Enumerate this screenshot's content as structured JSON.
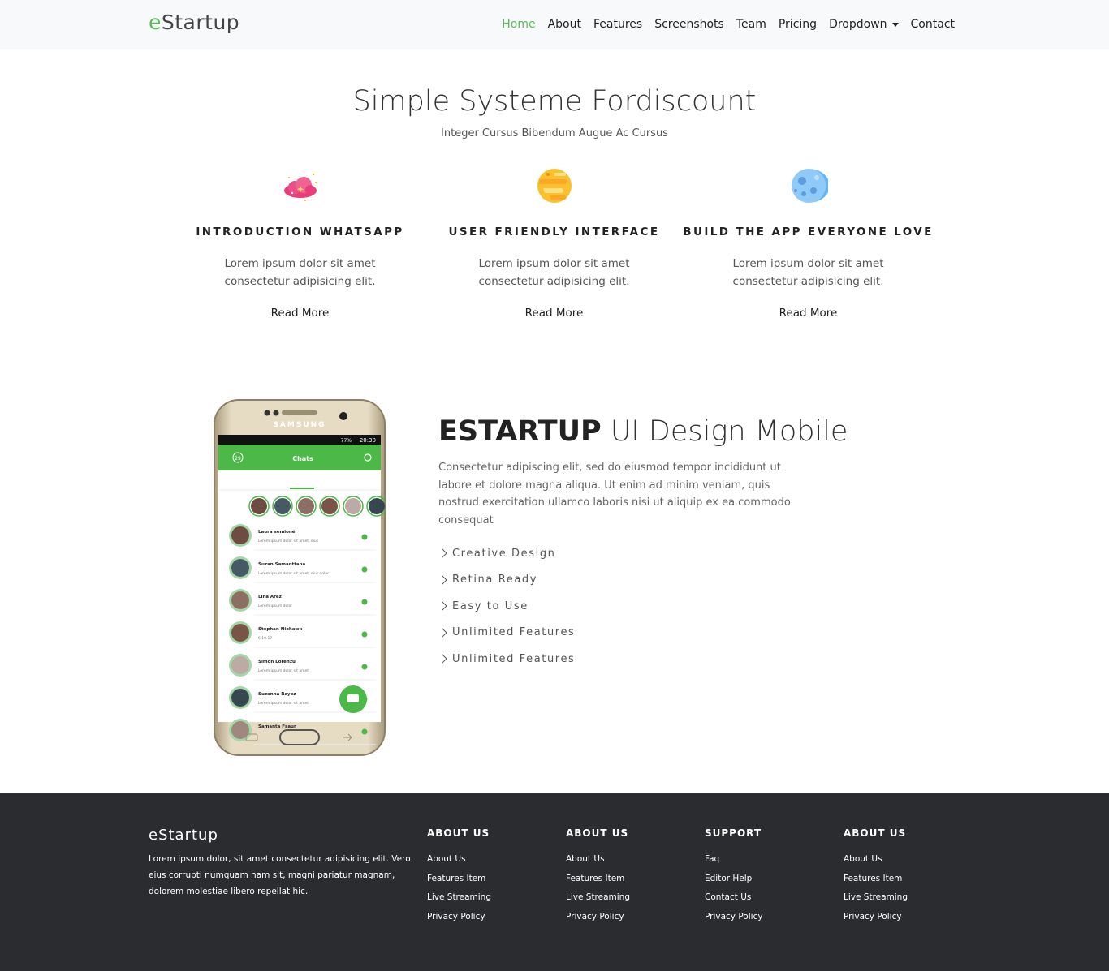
{
  "nav": {
    "brand_prefix": "e",
    "brand_rest": "Startup",
    "items": [
      "Home",
      "About",
      "Features",
      "Screenshots",
      "Team",
      "Pricing",
      "Dropdown",
      "Contact"
    ],
    "active": "Home"
  },
  "intro": {
    "title": "Simple Systeme Fordiscount",
    "subtitle": "Integer Cursus Bibendum Augue Ac Cursus"
  },
  "features": [
    {
      "icon": "cloud-icon",
      "title": "INTRODUCTION WHATSAPP",
      "text": "Lorem ipsum dolor sit amet consectetur adipisicing elit.",
      "link": "Read More"
    },
    {
      "icon": "planet-icon",
      "title": "USER FRIENDLY INTERFACE",
      "text": "Lorem ipsum dolor sit amet consectetur adipisicing elit.",
      "link": "Read More"
    },
    {
      "icon": "moon-icon",
      "title": "BUILD THE APP EVERYONE LOVE",
      "text": "Lorem ipsum dolor sit amet consectetur adipisicing elit.",
      "link": "Read More"
    }
  ],
  "mobile": {
    "title_bold": "ESTARTUP",
    "title_light": " UI Design Mobile",
    "text": "Consectetur adipiscing elit, sed do eiusmod tempor incididunt ut labore et dolore magna aliqua. Ut enim ad minim veniam, quis nostrud exercitation ullamco laboris nisi ut aliquip ex ea commodo consequat",
    "list": [
      "Creative Design",
      "Retina Ready",
      "Easy to Use",
      "Unlimited Features",
      "Unlimited Features"
    ]
  },
  "phone": {
    "brand": "SAMSUNG",
    "time": "20:30",
    "battery": "77%",
    "header": "Chats",
    "badge": "29",
    "chats": [
      {
        "name": "Laura semioné",
        "msg": "Lorem ipsum dolor sit amet, eius"
      },
      {
        "name": "Suzan Samanttana",
        "msg": "Lorem ipsum dolor sit amet, eius dolor"
      },
      {
        "name": "Lina Arez",
        "msg": "Lorem ipsum dolor"
      },
      {
        "name": "Stephan Niehawk",
        "msg": "€ 10.17"
      },
      {
        "name": "Simon Lorenzu",
        "msg": "Lorem ipsum dolor sit amet"
      },
      {
        "name": "Suzanna Rayez",
        "msg": "Lorem ipsum dolor sit amet"
      },
      {
        "name": "Samanta Fsaur",
        "msg": ""
      }
    ]
  },
  "footer": {
    "brand": "eStartup",
    "desc": "Lorem ipsum dolor, sit amet consectetur adipisicing elit. Vero eius corrupti numquam nam sit, magni pariatur magnam, dolorem molestiae libero repellat hic.",
    "columns": [
      {
        "title": "ABOUT US",
        "links": [
          "About Us",
          "Features Item",
          "Live Streaming",
          "Privacy Policy"
        ]
      },
      {
        "title": "ABOUT US",
        "links": [
          "About Us",
          "Features Item",
          "Live Streaming",
          "Privacy Policy"
        ]
      },
      {
        "title": "SUPPORT",
        "links": [
          "Faq",
          "Editor Help",
          "Contact Us",
          "Privacy Policy"
        ]
      },
      {
        "title": "ABOUT US",
        "links": [
          "About Us",
          "Features Item",
          "Live Streaming",
          "Privacy Policy"
        ]
      }
    ]
  },
  "colors": {
    "accent": "#5cb85c",
    "footer_bg": "#2b2c30",
    "navbar_bg": "#f8f9fa"
  }
}
